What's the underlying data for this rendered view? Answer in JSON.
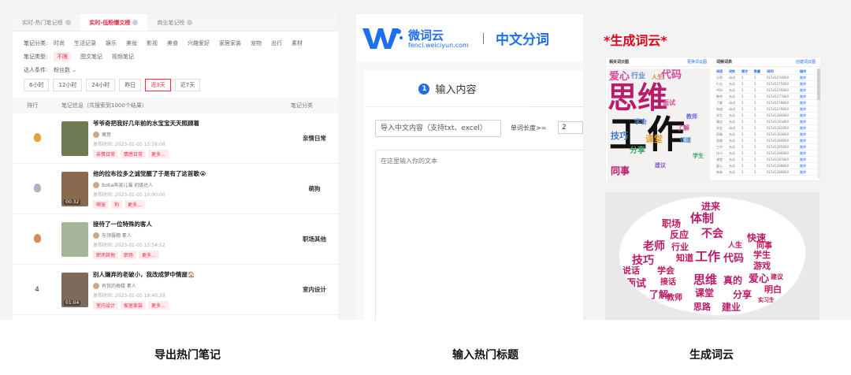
{
  "panel1": {
    "tabs": [
      "实时-热门笔记榜",
      "实时-低粉爆文榜",
      "商业笔记榜"
    ],
    "active_tab": 1,
    "filters": {
      "category_label": "笔记分类:",
      "categories": [
        "时尚",
        "生活记录",
        "娱乐",
        "美妆",
        "影视",
        "美食",
        "兴趣爱好",
        "家居家装",
        "宠物",
        "出行",
        "素材"
      ],
      "type_label": "笔记类型:",
      "types": [
        "不限",
        "图文笔记",
        "视频笔记"
      ],
      "expert_label": "达人条件:",
      "expert_value": "粉丝数 ⌄"
    },
    "time_options": [
      "6小时",
      "12小时",
      "24小时",
      "昨日",
      "近3天",
      "近7天"
    ],
    "time_selected": 4,
    "table_header": {
      "rank": "排行",
      "info": "笔记信息（共搜索到1000个结果）",
      "category": "笔记分类"
    },
    "rows": [
      {
        "rank": "",
        "medal": "#e6a23c",
        "title": "爷爷奇把我好几年前的水宝宝天天照顾着",
        "author": "寓意",
        "published": "发布时间: 2023-02-05 15:26:08",
        "tags": [
          "亲情日常",
          "情感日常",
          "更多..."
        ],
        "duration": "",
        "category": "亲情日常",
        "thumb": "#6f7a55"
      },
      {
        "rank": "",
        "medal": "#aab4c8",
        "title": "他的拉布拉多之诚觉醒了于是有了这首歌😭",
        "author": "Boba奔波儿灞  初级达人",
        "published": "发布时间: 2023-02-05 10:00:00",
        "tags": [
          "萌宠",
          "狗",
          "更多..."
        ],
        "duration": "00:32",
        "category": "萌狗",
        "thumb": "#8a6a4e"
      },
      {
        "rank": "",
        "medal": "#d88a5a",
        "title": "接待了一位特殊的客人",
        "author": "东领摄穗  素人",
        "published": "发布时间: 2023-02-05 15:54:52",
        "tags": [
          "职场其他",
          "职场",
          "更多..."
        ],
        "duration": "",
        "category": "职场其他",
        "thumb": "#a7b39a"
      },
      {
        "rank": "4",
        "medal": "",
        "title": "别人嫌弃的老破小，我改成梦中情屋🏠",
        "author": "有我的梅楼  素人",
        "published": "发布时间: 2023-02-05 19:40:28",
        "tags": [
          "室内设计",
          "家居家装",
          "更多..."
        ],
        "duration": "01:04",
        "category": "室内设计",
        "thumb": "#7d6a5a"
      }
    ]
  },
  "panel2": {
    "brand_name": "微词云",
    "brand_url": "fenci.weiciyun.com",
    "title": "中文分词",
    "step_number": "1",
    "step_label": "输入内容",
    "upload_label": "导入中文内容（支持txt、excel）",
    "length_label": "单词长度>=",
    "length_value": "2",
    "textarea_placeholder": "在这里输入你的文本"
  },
  "panel3": {
    "title": "*生成词云*",
    "left_header": "相关词云图",
    "left_link": "更换词云图",
    "right_header": "词频词表",
    "right_link": "创建词云图",
    "table_header": [
      "词语",
      "词性",
      "频次",
      "数量",
      "词ID",
      "操作"
    ],
    "table_rows": [
      [
        "分享",
        "动词",
        "2",
        "2",
        "02141274800",
        "删除"
      ],
      [
        "行业",
        "名词",
        "2",
        "2",
        "02141275800",
        "删除"
      ],
      [
        "代码",
        "名词",
        "2",
        "2",
        "02141276800",
        "删除"
      ],
      [
        "教师",
        "名词",
        "2",
        "2",
        "02141277800",
        "删除"
      ],
      [
        "了解",
        "动词",
        "2",
        "2",
        "02141278800",
        "删除"
      ],
      [
        "知道",
        "动词",
        "2",
        "2",
        "02141279800",
        "删除"
      ],
      [
        "学生",
        "名词",
        "2",
        "2",
        "02141280800",
        "删除"
      ],
      [
        "建议",
        "名词",
        "2",
        "2",
        "02141281800",
        "删除"
      ],
      [
        "学会",
        "动词",
        "2",
        "2",
        "02141282800",
        "删除"
      ],
      [
        "同事",
        "名词",
        "2",
        "2",
        "02141283800",
        "删除"
      ],
      [
        "思维",
        "名词",
        "2",
        "2",
        "02141284800",
        "删除"
      ],
      [
        "工作",
        "名词",
        "2",
        "2",
        "02141285800",
        "删除"
      ],
      [
        "技巧",
        "名词",
        "2",
        "2",
        "02141286800",
        "删除"
      ],
      [
        "课堂",
        "名词",
        "2",
        "2",
        "02141287800",
        "删除"
      ],
      [
        "爱心",
        "名词",
        "2",
        "2",
        "02141288800",
        "删除"
      ],
      [
        "体制",
        "名词",
        "2",
        "2",
        "02141289800",
        "删除"
      ]
    ],
    "cloud1_words": [
      "爱心",
      "行业",
      "人生",
      "代码",
      "思维",
      "工作",
      "技巧",
      "课堂",
      "分享",
      "学会",
      "了解",
      "教师",
      "知道",
      "学生",
      "建议",
      "同事",
      "面试"
    ],
    "cloud2_words": [
      "进来",
      "体制",
      "职场",
      "反应",
      "不会",
      "老师",
      "行业",
      "快速",
      "技巧",
      "知道",
      "工作",
      "代码",
      "学生",
      "人生",
      "说话",
      "学会",
      "游戏",
      "面试",
      "接话",
      "思维",
      "真的",
      "爱心",
      "社交",
      "了解",
      "课堂",
      "分享",
      "明白",
      "教师",
      "思路",
      "建业",
      "实习生",
      "同事",
      "建议"
    ]
  },
  "captions": [
    "导出热门笔记",
    "输入热门标题",
    "生成词云"
  ]
}
